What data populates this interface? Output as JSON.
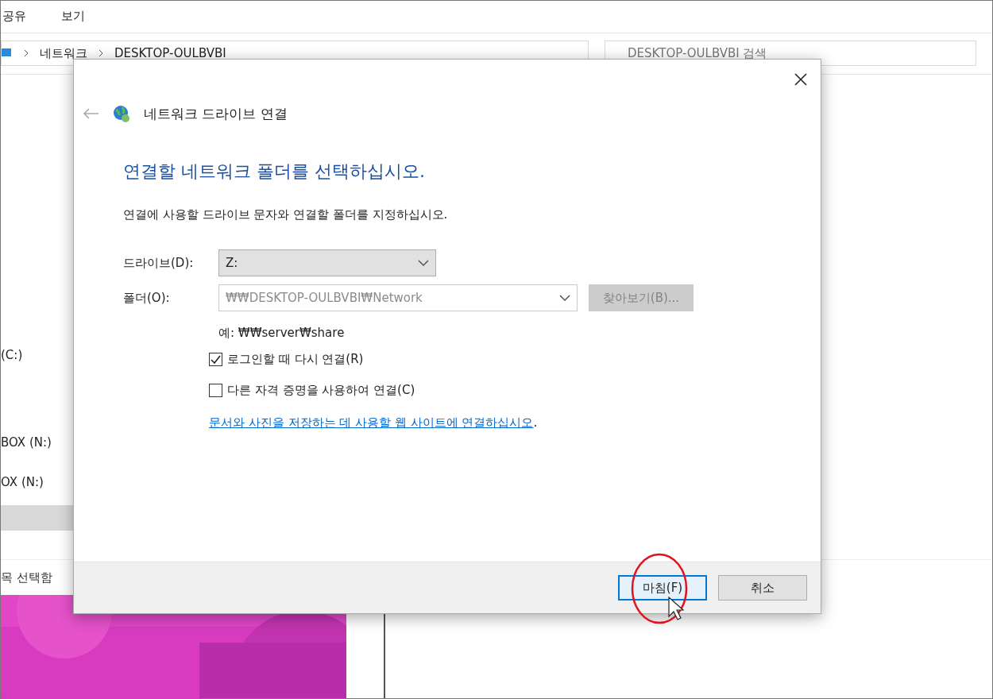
{
  "explorer": {
    "ribbon_tabs": [
      {
        "label": "공유"
      },
      {
        "label": "보기"
      }
    ],
    "breadcrumb": [
      "네트워크",
      "DESKTOP-OULBVBI"
    ],
    "search": {
      "placeholder": "DESKTOP-OULBVBI 검색"
    },
    "nav_items": [
      {
        "label": "(C:)",
        "selected": false
      },
      {
        "label": "BOX (N:)",
        "selected": false
      },
      {
        "label": "OX (N:)",
        "selected": false
      },
      {
        "selected": true
      }
    ],
    "status": "목 선택함"
  },
  "dialog": {
    "title": "네트워크 드라이브 연결",
    "heading": "연결할 네트워크 폴더를 선택하십시오.",
    "intro": "연결에 사용할 드라이브 문자와 연결할 폴더를 지정하십시오.",
    "drive": {
      "label": "드라이브(D):",
      "value": "Z:"
    },
    "folder": {
      "label": "폴더(O):",
      "value": "₩₩DESKTOP-OULBVBI₩Network",
      "disabled": true
    },
    "browse_button": {
      "label": "찾아보기(B)...",
      "disabled": true
    },
    "example": "예: ₩₩server₩share",
    "options": [
      {
        "label": "로그인할 때 다시 연결(R)",
        "checked": true
      },
      {
        "label": "다른 자격 증명을 사용하여 연결(C)",
        "checked": false
      }
    ],
    "link": "문서와 사진을 저장하는 데 사용할 웹 사이트에 연결하십시오",
    "link_end": ".",
    "buttons": [
      {
        "label": "마침(F)",
        "kind": "default"
      },
      {
        "label": "취소",
        "kind": "normal"
      }
    ]
  }
}
